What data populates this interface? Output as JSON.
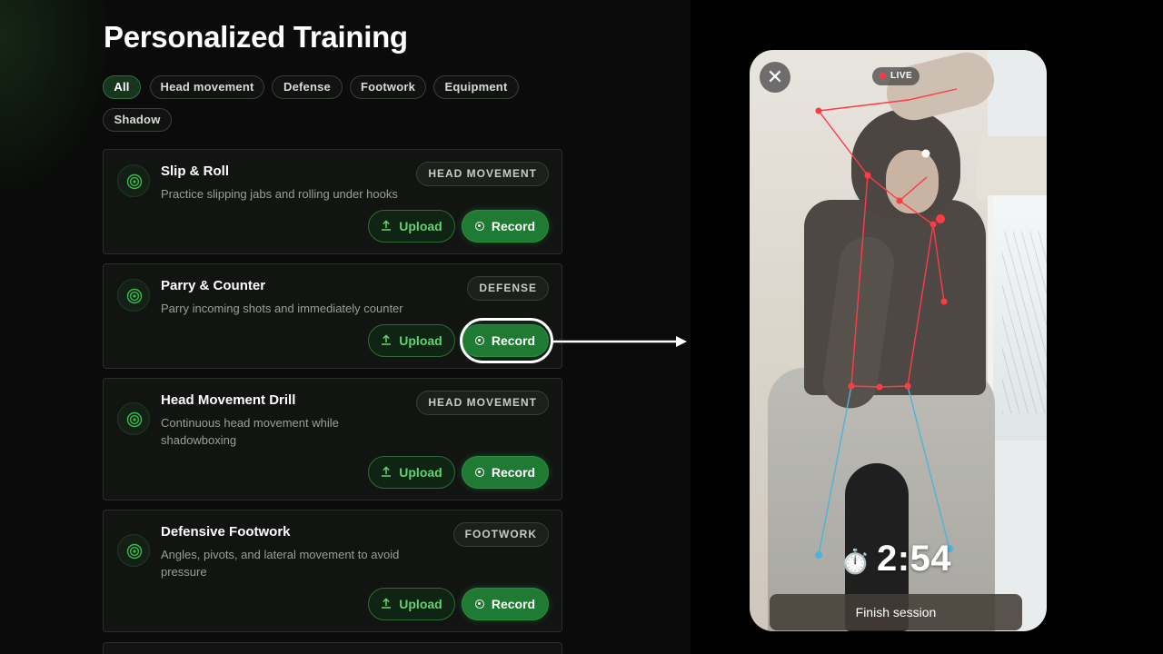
{
  "page": {
    "title": "Personalized Training"
  },
  "filters": [
    {
      "label": "All",
      "active": true
    },
    {
      "label": "Head movement",
      "active": false
    },
    {
      "label": "Defense",
      "active": false
    },
    {
      "label": "Footwork",
      "active": false
    },
    {
      "label": "Equipment",
      "active": false
    },
    {
      "label": "Shadow",
      "active": false
    }
  ],
  "drills": [
    {
      "title": "Slip & Roll",
      "description": "Practice slipping jabs and rolling under hooks",
      "tag": "HEAD MOVEMENT",
      "upload_label": "Upload",
      "record_label": "Record"
    },
    {
      "title": "Parry & Counter",
      "description": "Parry incoming shots and immediately counter",
      "tag": "DEFENSE",
      "upload_label": "Upload",
      "record_label": "Record"
    },
    {
      "title": "Head Movement Drill",
      "description": "Continuous head movement while shadowboxing",
      "tag": "HEAD MOVEMENT",
      "upload_label": "Upload",
      "record_label": "Record"
    },
    {
      "title": "Defensive Footwork",
      "description": "Angles, pivots, and lateral movement to avoid pressure",
      "tag": "FOOTWORK",
      "upload_label": "Upload",
      "record_label": "Record"
    }
  ],
  "session": {
    "live_label": "LIVE",
    "close_icon": "close-icon",
    "stopwatch_icon": "⏱️",
    "timer": "2:54",
    "finish_label": "Finish session"
  },
  "colors": {
    "accent_green": "#1f7a33",
    "upload_text": "#5fd56f",
    "skeleton_red": "#ff3b45",
    "skeleton_blue": "#4fb3d9"
  }
}
